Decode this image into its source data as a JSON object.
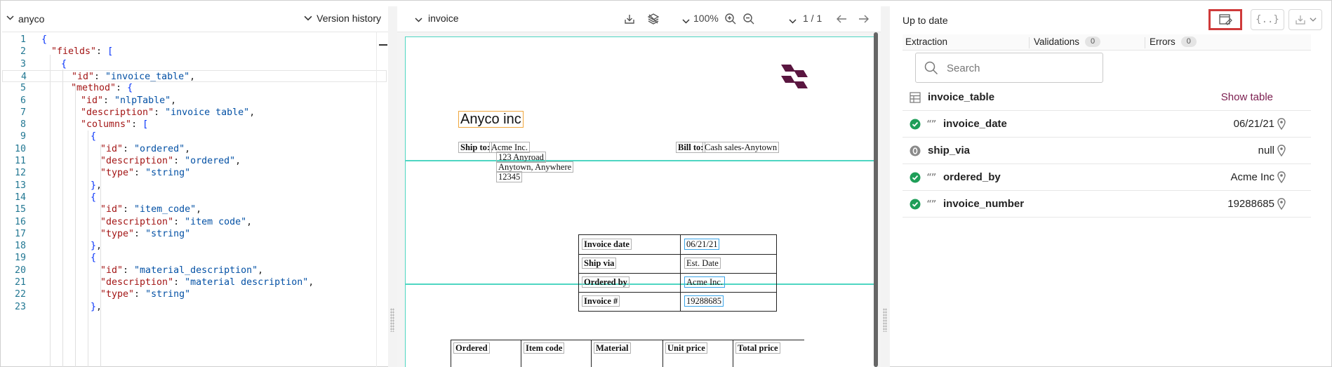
{
  "left_panel": {
    "title": "anyco",
    "version_history_label": "Version history",
    "code_lines": [
      {
        "n": "1",
        "t": "{"
      },
      {
        "n": "2",
        "t": "\"fields\": ["
      },
      {
        "n": "3",
        "t": "{"
      },
      {
        "n": "4",
        "t": "\"id\": \"invoice_table\","
      },
      {
        "n": "5",
        "t": "\"method\": {"
      },
      {
        "n": "6",
        "t": "\"id\": \"nlpTable\","
      },
      {
        "n": "7",
        "t": "\"description\": \"invoice table\","
      },
      {
        "n": "8",
        "t": "\"columns\": ["
      },
      {
        "n": "9",
        "t": "{"
      },
      {
        "n": "10",
        "t": "\"id\": \"ordered\","
      },
      {
        "n": "11",
        "t": "\"description\": \"ordered\","
      },
      {
        "n": "12",
        "t": "\"type\": \"string\""
      },
      {
        "n": "13",
        "t": "},"
      },
      {
        "n": "14",
        "t": "{"
      },
      {
        "n": "15",
        "t": "\"id\": \"item_code\","
      },
      {
        "n": "16",
        "t": "\"description\": \"item code\","
      },
      {
        "n": "17",
        "t": "\"type\": \"string\""
      },
      {
        "n": "18",
        "t": "},"
      },
      {
        "n": "19",
        "t": "{"
      },
      {
        "n": "20",
        "t": "\"id\": \"material_description\","
      },
      {
        "n": "21",
        "t": "\"description\": \"material description\","
      },
      {
        "n": "22",
        "t": "\"type\": \"string\""
      },
      {
        "n": "23",
        "t": "},"
      }
    ]
  },
  "middle_panel": {
    "title": "invoice",
    "zoom": "100%",
    "page_indicator": "1 / 1",
    "document": {
      "company_name": "Anyco inc",
      "ship_to_label": "Ship to:",
      "ship_to_lines": [
        "Acme Inc.",
        "123 Anyroad",
        "Anytown, Anywhere",
        "12345"
      ],
      "bill_to_label": "Bill to:",
      "bill_to_value": "Cash sales-Anytown",
      "info_rows": [
        {
          "label": "Invoice date",
          "value": "06/21/21"
        },
        {
          "label": "Ship via",
          "value": "Est. Date"
        },
        {
          "label": "Ordered by",
          "value": "Acme Inc."
        },
        {
          "label": "Invoice #",
          "value": "19288685"
        }
      ],
      "item_headers": [
        "Ordered",
        "Item code",
        "Material",
        "Unit price",
        "Total price"
      ]
    }
  },
  "right_panel": {
    "status": "Up to date",
    "tabs": [
      {
        "label": "Extraction",
        "count": ""
      },
      {
        "label": "Validations",
        "count": "0"
      },
      {
        "label": "Errors",
        "count": "0"
      }
    ],
    "search_placeholder": "Search",
    "table_field": {
      "name": "invoice_table",
      "action": "Show table"
    },
    "fields": [
      {
        "name": "invoice_date",
        "value": "06/21/21",
        "status": "valid"
      },
      {
        "name": "ship_via",
        "value": "null",
        "status": "empty"
      },
      {
        "name": "ordered_by",
        "value": "Acme Inc",
        "status": "valid"
      },
      {
        "name": "invoice_number",
        "value": "19288685",
        "status": "valid"
      }
    ],
    "colors": {
      "valid": "#1e9e58",
      "empty": "#8a8a8a",
      "accent": "#7b1d4f",
      "highlight": "#cf3a3a",
      "logo": "#5a1640",
      "region": "#4ed6c2"
    }
  }
}
